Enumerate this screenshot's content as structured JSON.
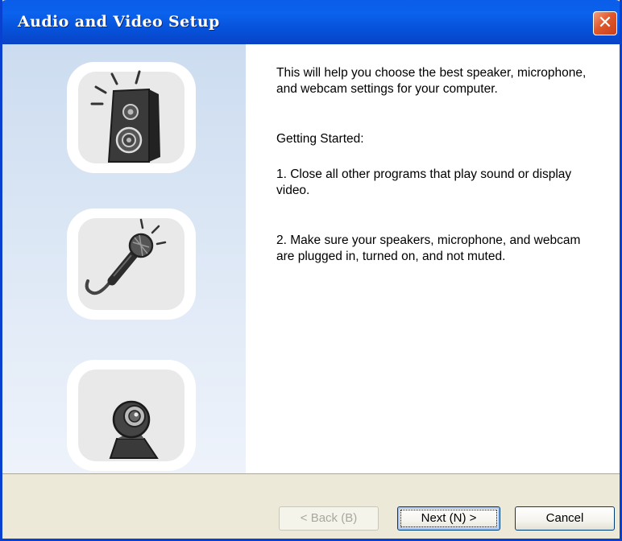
{
  "window": {
    "title": "Audio and Video Setup",
    "close_glyph": "✕"
  },
  "icons": {
    "speaker": "speaker-icon",
    "microphone": "microphone-icon",
    "webcam": "webcam-icon"
  },
  "content": {
    "intro": "This will help you choose the best speaker, microphone, and webcam settings for your computer.",
    "heading": "Getting Started:",
    "step1": "1. Close all other programs that play sound or display video.",
    "step2": "2. Make sure your speakers, microphone, and webcam are plugged in, turned on, and not muted."
  },
  "footer": {
    "back_label": "< Back (B)",
    "back_enabled": false,
    "next_label": "Next (N) >",
    "cancel_label": "Cancel"
  },
  "colors": {
    "titlebar": "#0a5de8",
    "accent_border": "#0841d0",
    "panel": "#dce7f5",
    "close": "#e0582c"
  }
}
